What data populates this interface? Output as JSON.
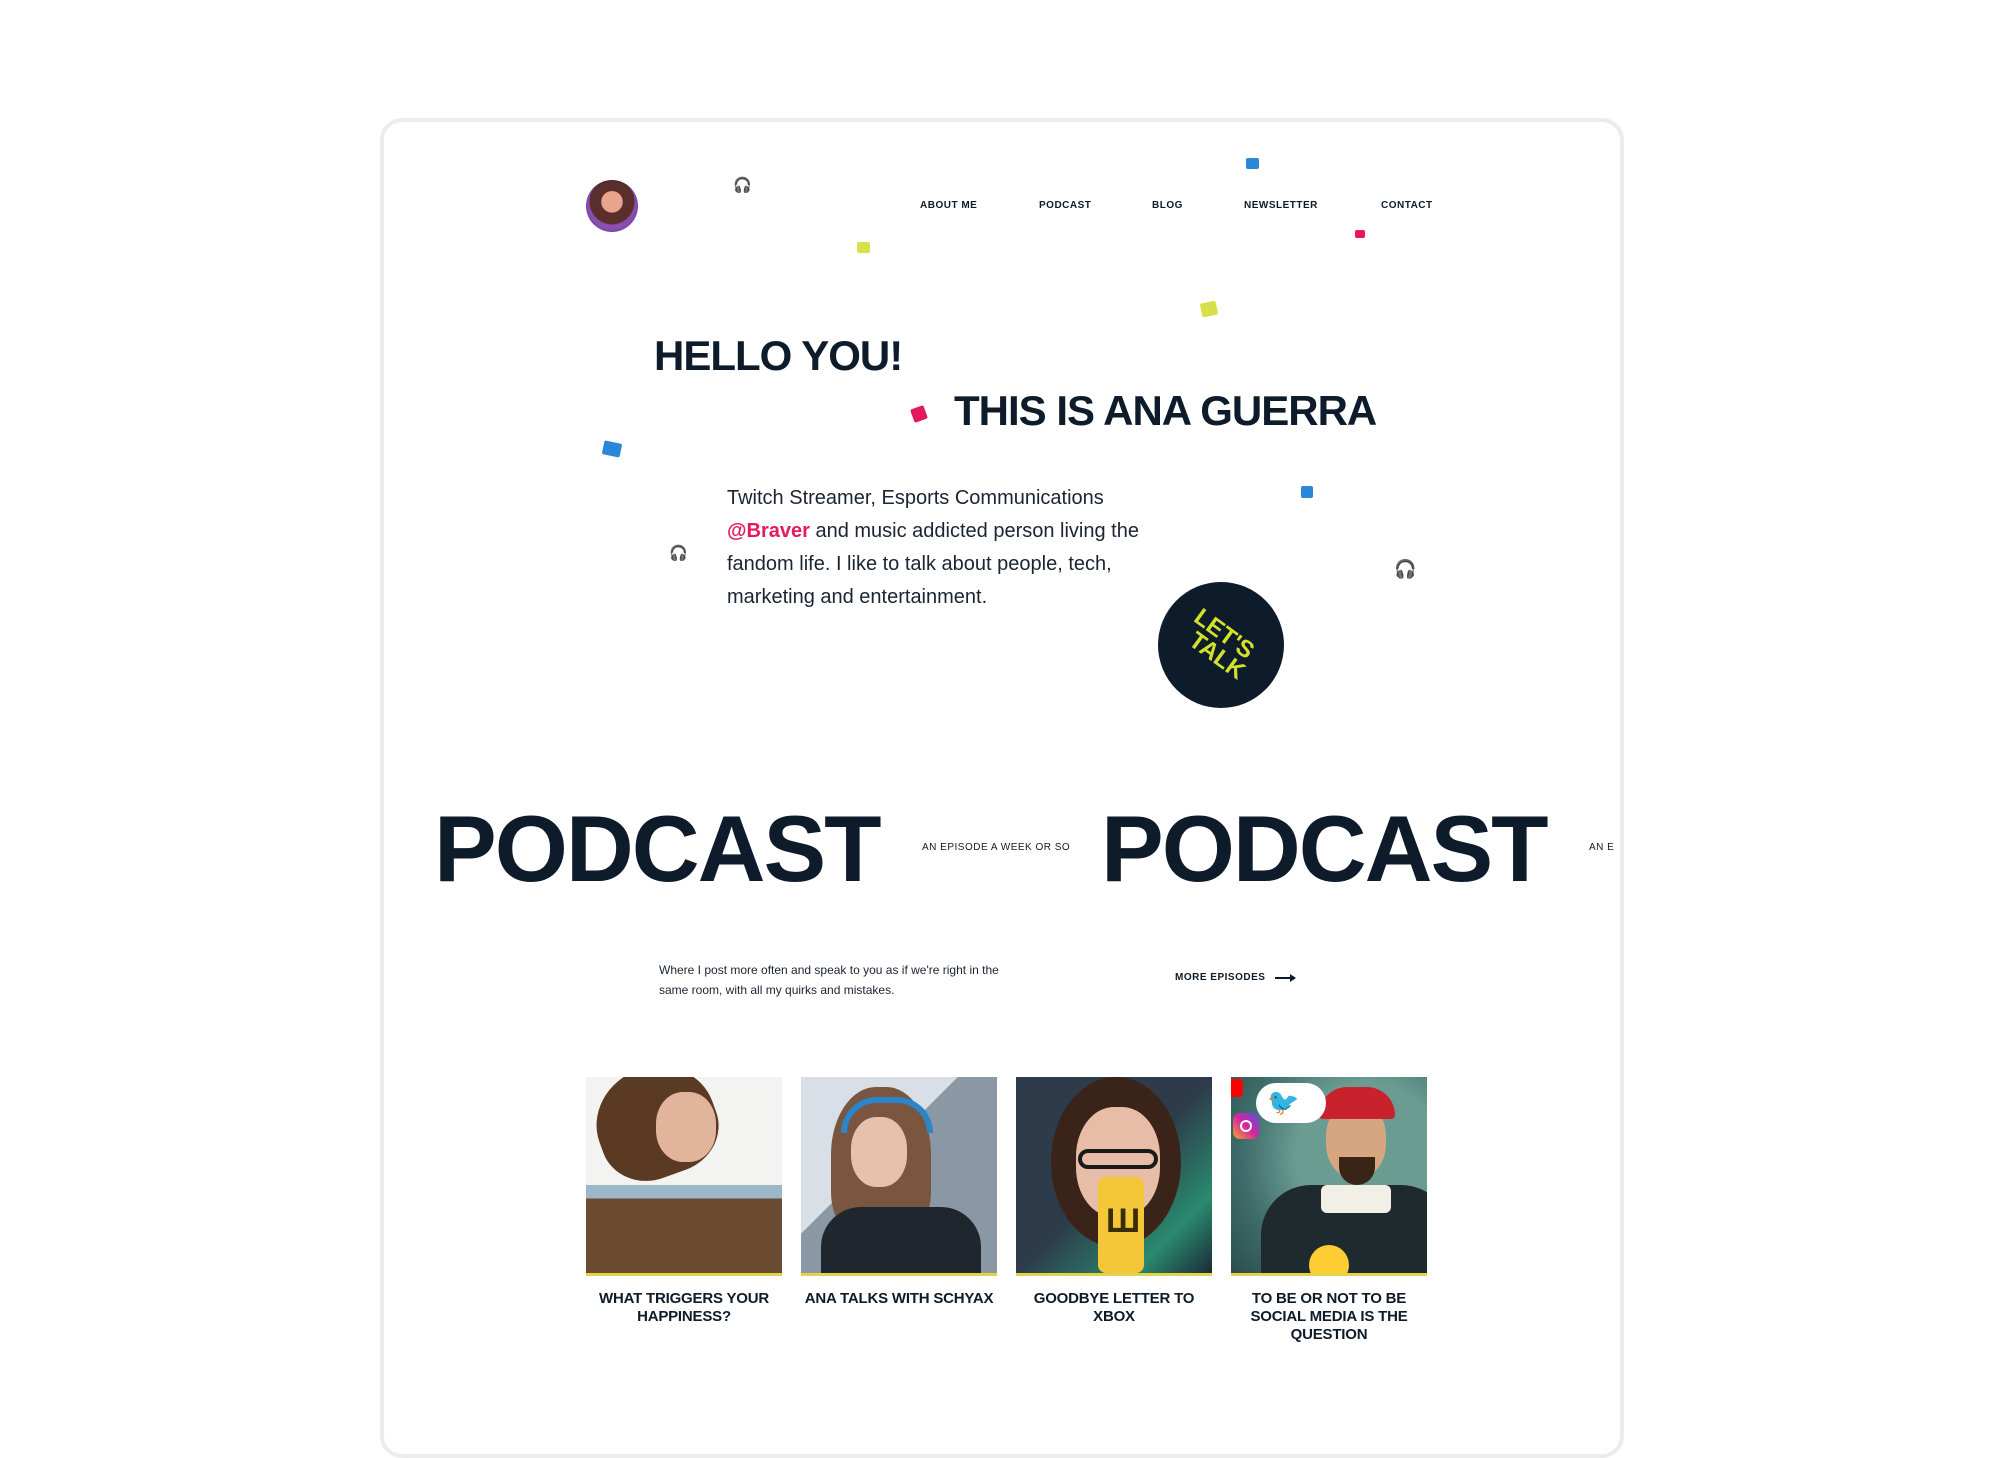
{
  "colors": {
    "ink": "#0d1b2a",
    "accent_pink": "#e5195e",
    "accent_lime": "#d4e12a",
    "confetti_blue": "#2a86d9",
    "confetti_lime": "#d7e04a",
    "confetti_red": "#e5195e"
  },
  "header": {
    "avatar_icon": "profile-avatar",
    "nav": [
      {
        "label": "ABOUT ME"
      },
      {
        "label": "PODCAST"
      },
      {
        "label": "BLOG"
      },
      {
        "label": "NEWSLETTER"
      },
      {
        "label": "CONTACT"
      }
    ]
  },
  "hero": {
    "greeting": "HELLO YOU!",
    "name_line": "THIS IS ANA GUERRA",
    "intro_before": "Twitch Streamer, Esports Communications ",
    "intro_link": "@Braver",
    "intro_after": " and music addicted person living the fandom life. I like to talk about people, tech, marketing and entertainment.",
    "cta_line1": "LET'S",
    "cta_line2": "TALK"
  },
  "podcast": {
    "marquee_word_1": "PODCAST",
    "marquee_tag_1": "AN EPISODE A WEEK OR SO",
    "marquee_word_2": "PODCAST",
    "marquee_tag_2": "AN E",
    "description": "Where I post more often and speak to you as if we're right in the same room, with all my quirks and mistakes.",
    "more_label": "MORE EPISODES",
    "episodes": [
      {
        "title": "WHAT TRIGGERS YOUR HAPPINESS?"
      },
      {
        "title": "ANA TALKS WITH SCHYAX"
      },
      {
        "title": "GOODBYE LETTER TO XBOX"
      },
      {
        "title": "TO BE OR NOT TO BE SOCIAL MEDIA IS THE QUESTION"
      }
    ]
  }
}
